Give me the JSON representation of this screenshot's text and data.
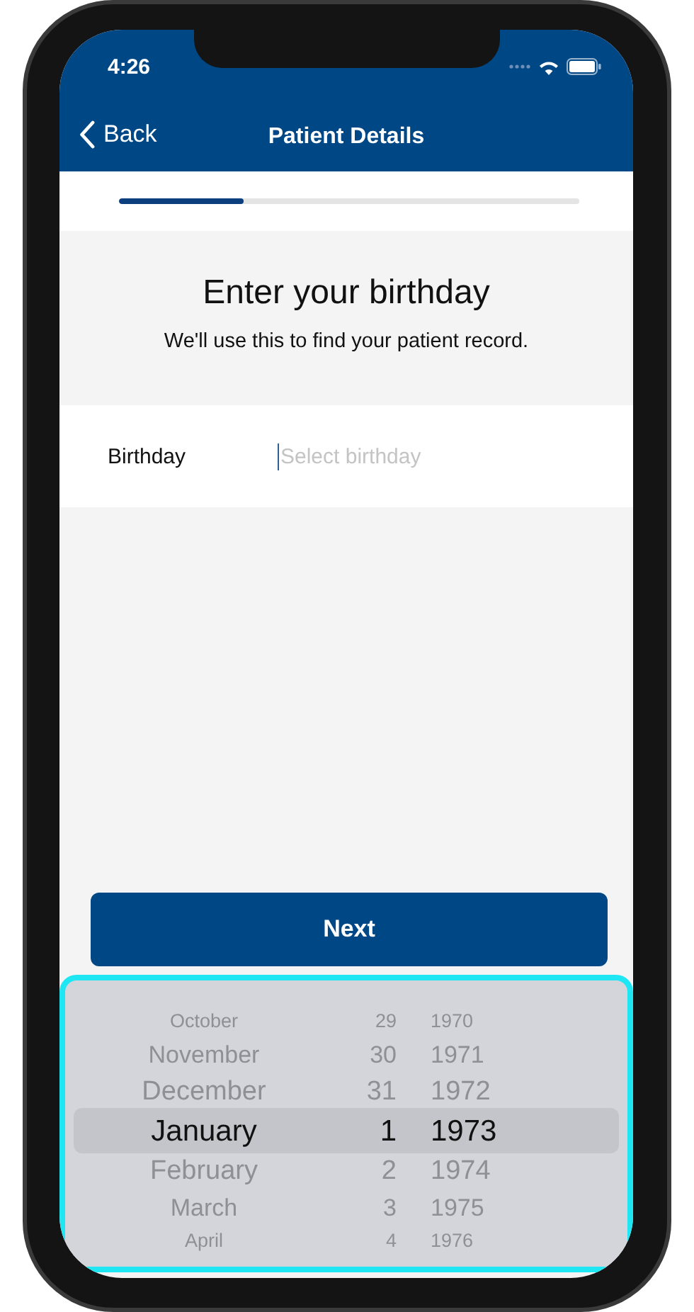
{
  "status_bar": {
    "time": "4:26"
  },
  "nav_bar": {
    "back": "Back",
    "title": "Patient Details"
  },
  "progress": {
    "level": 0.27
  },
  "heading": "Enter your birthday",
  "subheading": "We'll use this to find your patient record.",
  "birthday_field": {
    "label": "Birthday",
    "placeholder": "Select birthday"
  },
  "next_button": "Next",
  "date_picker": {
    "rows": [
      {
        "month": "October",
        "day": "29",
        "year": "1970",
        "selected": false
      },
      {
        "month": "November",
        "day": "30",
        "year": "1971",
        "selected": false
      },
      {
        "month": "December",
        "day": "31",
        "year": "1972",
        "selected": false
      },
      {
        "month": "January",
        "day": "1",
        "year": "1973",
        "selected": true
      },
      {
        "month": "February",
        "day": "2",
        "year": "1974",
        "selected": false
      },
      {
        "month": "March",
        "day": "3",
        "year": "1975",
        "selected": false
      },
      {
        "month": "April",
        "day": "4",
        "year": "1976",
        "selected": false
      }
    ]
  }
}
